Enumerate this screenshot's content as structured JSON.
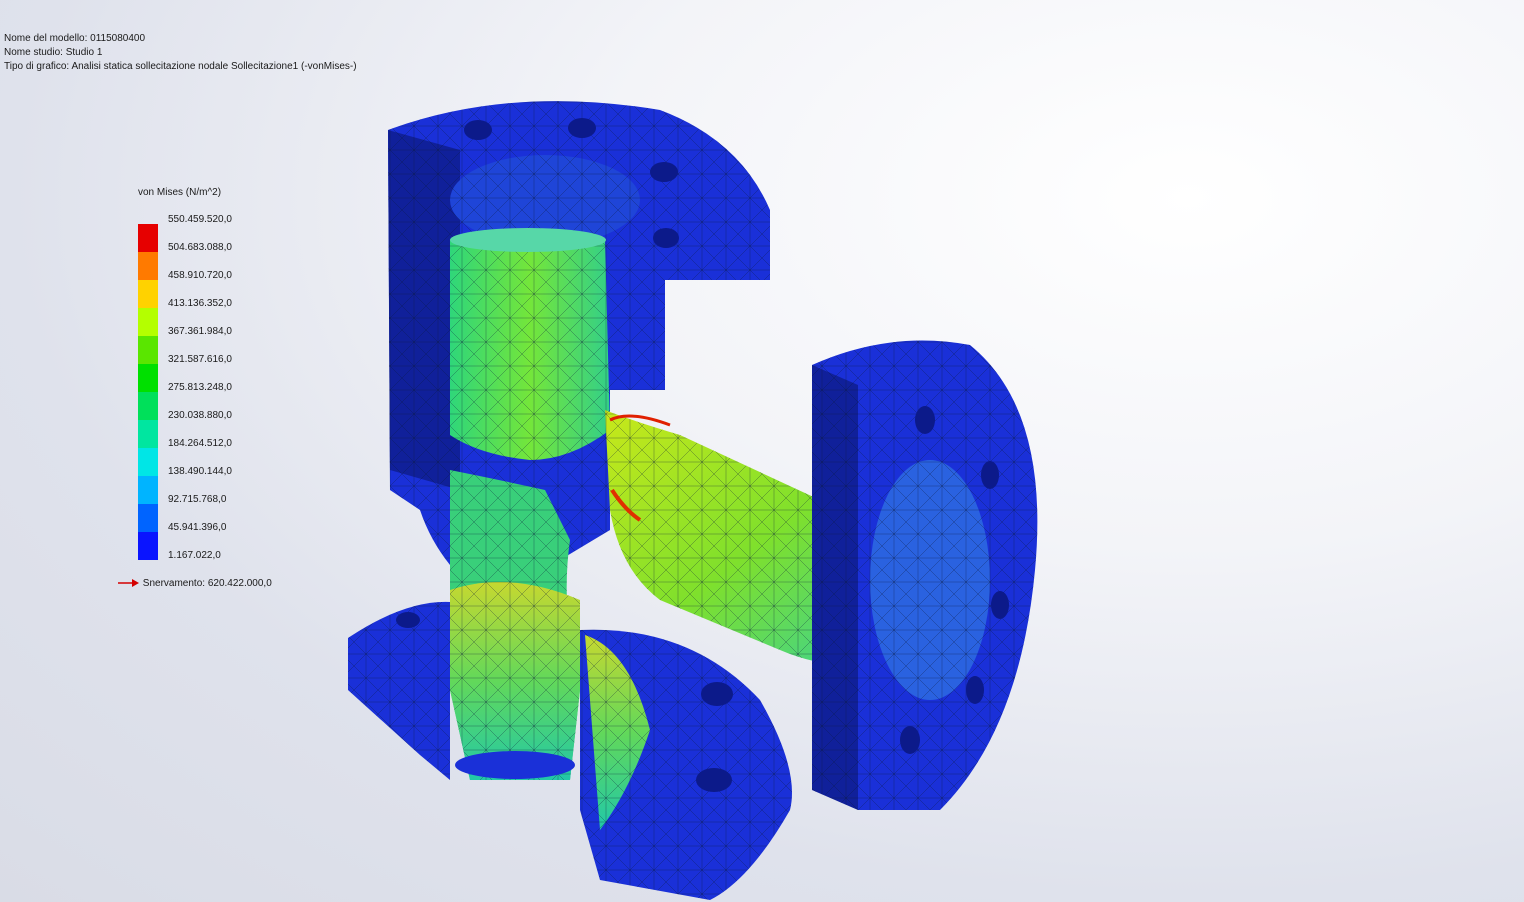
{
  "header": {
    "model_name": "Nome del modello: 0115080400",
    "study_name": "Nome studio: Studio 1",
    "plot_type": "Tipo di grafico: Analisi statica sollecitazione nodale Sollecitazione1 (-vonMises-)"
  },
  "legend": {
    "title": "von Mises (N/m^2)",
    "labels": [
      "550.459.520,0",
      "504.683.088,0",
      "458.910.720,0",
      "413.136.352,0",
      "367.361.984,0",
      "321.587.616,0",
      "275.813.248,0",
      "230.038.880,0",
      "184.264.512,0",
      "138.490.144,0",
      "92.715.768,0",
      "45.941.396,0",
      "1.167.022,0"
    ],
    "colors": [
      "#e60000",
      "#ff7a00",
      "#ffd200",
      "#b4ff00",
      "#5ae600",
      "#00e000",
      "#00e05a",
      "#00e6a0",
      "#00e6e6",
      "#00b4ff",
      "#0064ff",
      "#0a14ff"
    ],
    "yield_label": "Snervamento: 620.422.000,0",
    "yield_arrow_color": "#d40000"
  }
}
